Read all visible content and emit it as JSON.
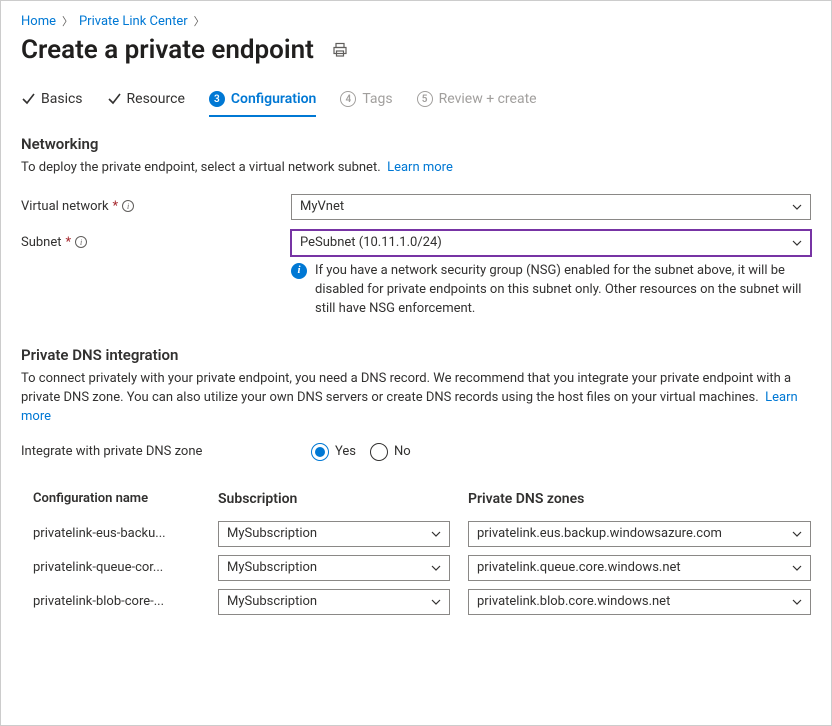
{
  "breadcrumb": {
    "home": "Home",
    "link_center": "Private Link Center"
  },
  "title": "Create a private endpoint",
  "tabs": {
    "basics": "Basics",
    "resource": "Resource",
    "configuration": "Configuration",
    "tags": "Tags",
    "review": "Review + create",
    "configNum": "3",
    "tagsNum": "4",
    "reviewNum": "5"
  },
  "networking": {
    "heading": "Networking",
    "desc": "To deploy the private endpoint, select a virtual network subnet.",
    "learn": "Learn more",
    "vnet_label": "Virtual network",
    "vnet_value": "MyVnet",
    "subnet_label": "Subnet",
    "subnet_value": "PeSubnet (10.11.1.0/24)",
    "subnet_info": "If you have a network security group (NSG) enabled for the subnet above, it will be disabled for private endpoints on this subnet only. Other resources on the subnet will still have NSG enforcement."
  },
  "dns": {
    "heading": "Private DNS integration",
    "desc": "To connect privately with your private endpoint, you need a DNS record. We recommend that you integrate your private endpoint with a private DNS zone. You can also utilize your own DNS servers or create DNS records using the host files on your virtual machines.",
    "learn": "Learn more",
    "integrate_label": "Integrate with private DNS zone",
    "yes": "Yes",
    "no": "No",
    "col_name": "Configuration name",
    "col_sub": "Subscription",
    "col_zone": "Private DNS zones",
    "rows": [
      {
        "name": "privatelink-eus-backu...",
        "subscription": "MySubscription",
        "zone": "privatelink.eus.backup.windowsazure.com"
      },
      {
        "name": "privatelink-queue-cor...",
        "subscription": "MySubscription",
        "zone": "privatelink.queue.core.windows.net"
      },
      {
        "name": "privatelink-blob-core-...",
        "subscription": "MySubscription",
        "zone": "privatelink.blob.core.windows.net"
      }
    ]
  }
}
